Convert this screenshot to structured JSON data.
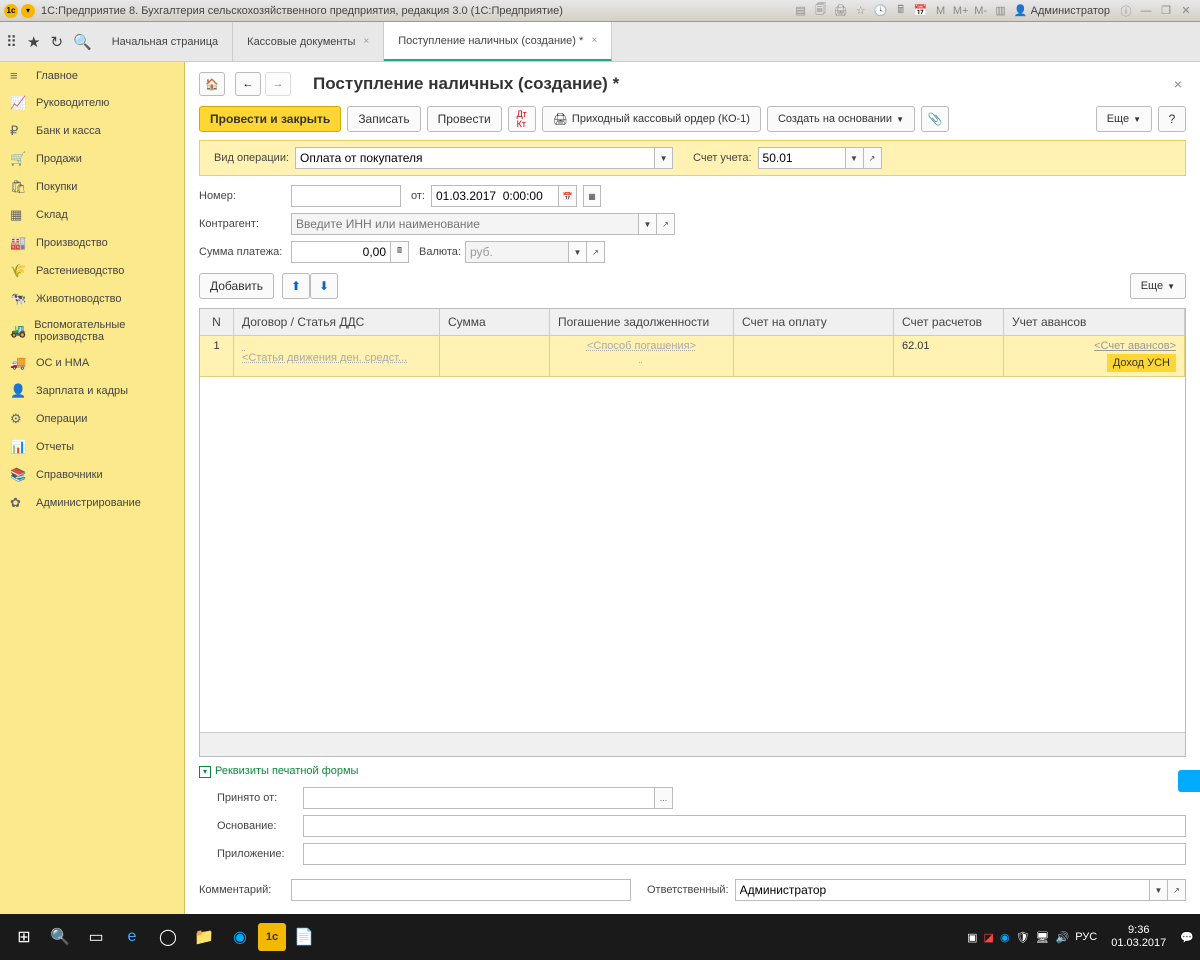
{
  "titlebar": {
    "title": "1С:Предприятие 8. Бухгалтерия сельскохозяйственного предприятия, редакция 3.0  (1С:Предприятие)",
    "user": "Администратор",
    "m": "M",
    "mplus": "M+",
    "mminus": "M-"
  },
  "tabs": {
    "t0": "Начальная страница",
    "t1": "Кассовые документы",
    "t2": "Поступление наличных (создание) *"
  },
  "sidebar": {
    "items": [
      {
        "icon": "≡",
        "label": "Главное"
      },
      {
        "icon": "📈",
        "label": "Руководителю"
      },
      {
        "icon": "₽",
        "label": "Банк и касса"
      },
      {
        "icon": "🛒",
        "label": "Продажи"
      },
      {
        "icon": "🛍",
        "label": "Покупки"
      },
      {
        "icon": "▦",
        "label": "Склад"
      },
      {
        "icon": "🏭",
        "label": "Производство"
      },
      {
        "icon": "🌾",
        "label": "Растениеводство"
      },
      {
        "icon": "🐄",
        "label": "Животноводство"
      },
      {
        "icon": "🚜",
        "label": "Вспомогательные производства"
      },
      {
        "icon": "🚚",
        "label": "ОС и НМА"
      },
      {
        "icon": "👤",
        "label": "Зарплата и кадры"
      },
      {
        "icon": "⚙",
        "label": "Операции"
      },
      {
        "icon": "📊",
        "label": "Отчеты"
      },
      {
        "icon": "📚",
        "label": "Справочники"
      },
      {
        "icon": "✿",
        "label": "Администрирование"
      }
    ]
  },
  "page": {
    "title": "Поступление наличных (создание) *",
    "toolbar": {
      "primary": "Провести и закрыть",
      "save": "Записать",
      "post": "Провести",
      "print": "Приходный кассовый ордер (КО-1)",
      "createbased": "Создать на основании",
      "more": "Еще",
      "help": "?"
    },
    "form": {
      "optype_label": "Вид операции:",
      "optype": "Оплата от покупателя",
      "account_label": "Счет учета:",
      "account": "50.01",
      "num_label": "Номер:",
      "date_label": "от:",
      "date": "01.03.2017  0:00:00",
      "contragent_label": "Контрагент:",
      "contragent_ph": "Введите ИНН или наименование",
      "sum_label": "Сумма платежа:",
      "sum": "0,00",
      "currency_label": "Валюта:",
      "currency": "руб.",
      "add": "Добавить",
      "more2": "Еще"
    },
    "table": {
      "cols": [
        "N",
        "Договор / Статья ДДС",
        "Сумма",
        "Погашение задолженности",
        "Счет на оплату",
        "Счет расчетов",
        "Учет авансов"
      ],
      "row": {
        "n": "1",
        "dds_ph": "<Статья движения ден. средст...",
        "pog_ph": "<Способ погашения>",
        "schet": "62.01",
        "avans_ph": "<Счет авансов>",
        "badge": "Доход УСН"
      }
    },
    "expander": "Реквизиты печатной формы",
    "printform": {
      "received_label": "Принято от:",
      "reason_label": "Основание:",
      "attach_label": "Приложение:"
    },
    "footer": {
      "comment_label": "Комментарий:",
      "resp_label": "Ответственный:",
      "resp": "Администратор"
    }
  },
  "taskbar": {
    "lang": "РУС",
    "time": "9:36",
    "date": "01.03.2017"
  }
}
